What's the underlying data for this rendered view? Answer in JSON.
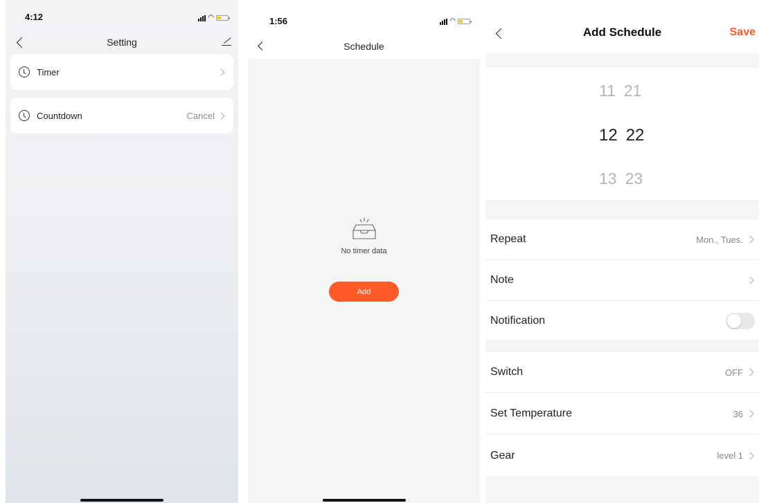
{
  "screen1": {
    "status_time": "4:12",
    "title": "Setting",
    "items": [
      {
        "label": "Timer",
        "value": ""
      },
      {
        "label": "Countdown",
        "value": "Cancel"
      }
    ]
  },
  "screen2": {
    "status_time": "1:56",
    "title": "Schedule",
    "empty_text": "No timer data",
    "add_label": "Add"
  },
  "screen3": {
    "title": "Add Schedule",
    "save_label": "Save",
    "picker": {
      "above": {
        "hour": "11",
        "minute": "21"
      },
      "selected": {
        "hour": "12",
        "minute": "22"
      },
      "below": {
        "hour": "13",
        "minute": "23"
      }
    },
    "rows": [
      {
        "label": "Repeat",
        "value": "Mon., Tues."
      },
      {
        "label": "Note",
        "value": ""
      },
      {
        "label": "Notification",
        "value": ""
      },
      {
        "label": "Switch",
        "value": "OFF"
      },
      {
        "label": "Set Temperature",
        "value": "36"
      },
      {
        "label": "Gear",
        "value": "level 1"
      }
    ],
    "notification_on": false
  },
  "colors": {
    "accent": "#ff5a28",
    "background": "#f4f5f7"
  }
}
